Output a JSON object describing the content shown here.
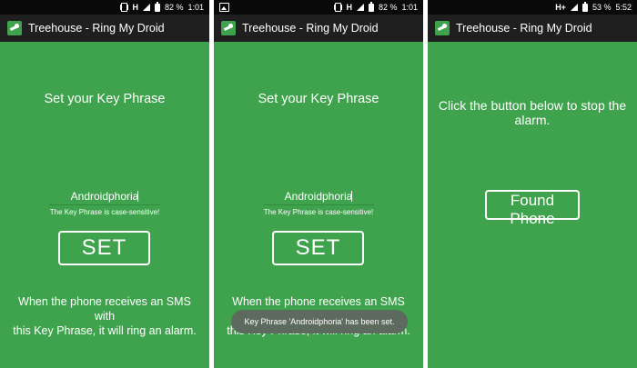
{
  "colors": {
    "background": "#3fa34d",
    "status_bar": "#0a0a0a",
    "title_bar": "#1f1f1f",
    "toast": "#5d6b5f"
  },
  "screens": [
    {
      "status": {
        "network": "H",
        "battery": "82 %",
        "time": "1:01"
      },
      "app_title": "Treehouse - Ring My Droid",
      "heading": "Set your Key Phrase",
      "key_phrase_value": "Androidphoria",
      "hint": "The Key Phrase is case-sensitive!",
      "set_label": "SET",
      "explanation_line1": "When the phone receives an SMS with",
      "explanation_line2": "this Key Phrase, it will ring an alarm."
    },
    {
      "status": {
        "network": "H",
        "battery": "82 %",
        "time": "1:01"
      },
      "app_title": "Treehouse - Ring My Droid",
      "heading": "Set your Key Phrase",
      "key_phrase_value": "Androidphoria",
      "hint": "The Key Phrase is case-sensitive!",
      "set_label": "SET",
      "explanation_line1": "When the phone receives an SMS with",
      "explanation_line2": "this Key Phrase, it will ring an alarm.",
      "toast": "Key Phrase 'Androidphoria' has been set."
    },
    {
      "status": {
        "network": "H+",
        "battery": "53 %",
        "time": "5:52"
      },
      "app_title": "Treehouse - Ring My Droid",
      "instruction_line1": "Click the button below to stop the",
      "instruction_line2": "alarm.",
      "found_label": "Found Phone"
    }
  ]
}
